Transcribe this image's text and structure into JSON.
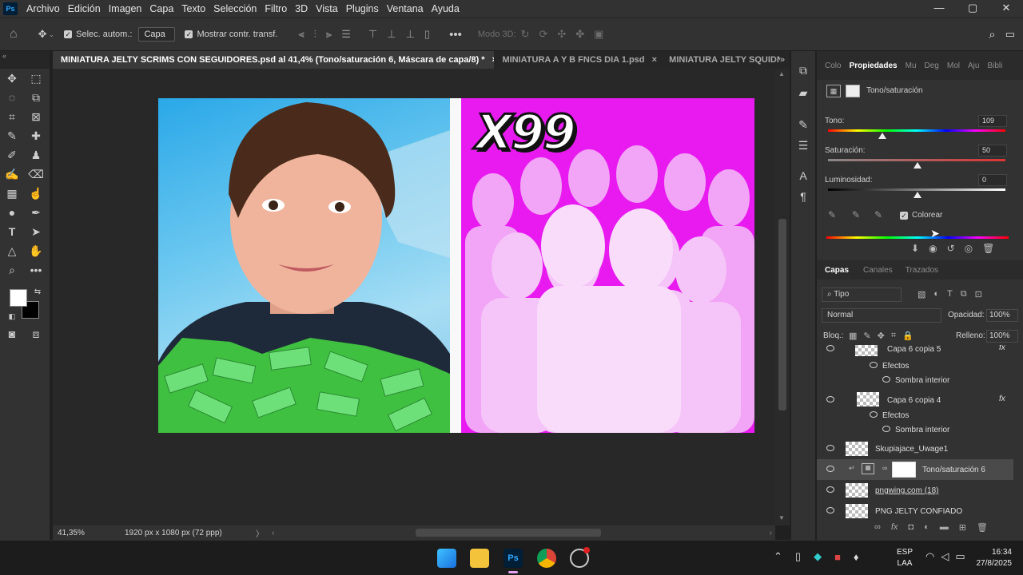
{
  "menu": {
    "items": [
      "Archivo",
      "Edición",
      "Imagen",
      "Capa",
      "Texto",
      "Selección",
      "Filtro",
      "3D",
      "Vista",
      "Plugins",
      "Ventana",
      "Ayuda"
    ]
  },
  "window_controls": {
    "minimize": "—",
    "restore": "▢",
    "close": "✕"
  },
  "options": {
    "auto_select_label": "Selec. autom.:",
    "auto_select_value": "Capa",
    "show_transform_label": "Mostrar contr. transf.",
    "mode3d_label": "Modo 3D:"
  },
  "tabs": [
    {
      "label": "MINIATURA JELTY SCRIMS CON SEGUIDORES.psd al 41,4% (Tono/saturación 6, Máscara de capa/8) *",
      "close": "×"
    },
    {
      "label": "MINIATURA A Y B FNCS DIA 1.psd",
      "close": "×"
    },
    {
      "label": "MINIATURA JELTY SQUIDNITE C",
      "close": ""
    }
  ],
  "tab_overflow": "»",
  "canvas": {
    "headline": "X99"
  },
  "status": {
    "zoom": "41,35%",
    "doc_info": "1920 px x 1080 px (72 ppp)"
  },
  "properties": {
    "tabs": [
      "Colo",
      "Propiedades",
      "Mu",
      "Deg",
      "Mol",
      "Aju",
      "Bibli"
    ],
    "title": "Tono/saturación",
    "tono_label": "Tono:",
    "tono_value": "109",
    "sat_label": "Saturación:",
    "sat_value": "50",
    "lum_label": "Luminosidad:",
    "lum_value": "0",
    "colorize_label": "Colorear"
  },
  "layers_panel": {
    "tabs": [
      "Capas",
      "Canales",
      "Trazados"
    ],
    "filter": "Tipo",
    "blend_mode": "Normal",
    "opacity_label": "Opacidad:",
    "opacity_value": "100%",
    "lock_label": "Bloq.:",
    "fill_label": "Relleno:",
    "fill_value": "100%",
    "layers": [
      {
        "name": "Capa 6 copia 5",
        "indent": false,
        "fx": true
      },
      {
        "name": "Efectos",
        "indent": true
      },
      {
        "name": "Sombra interior",
        "indent": true
      },
      {
        "name": "Capa 6 copia 4",
        "indent": false,
        "fx": true
      },
      {
        "name": "Efectos",
        "indent": true
      },
      {
        "name": "Sombra interior",
        "indent": true
      },
      {
        "name": "Skupiajace_Uwage1",
        "indent": false
      },
      {
        "name": "Tono/saturación 6",
        "indent": false,
        "selected": true
      },
      {
        "name": "pngwing.com (18)",
        "indent": false
      },
      {
        "name": "PNG JELTY CONFIADO",
        "indent": false
      }
    ],
    "fx_label": "fx"
  },
  "taskbar": {
    "lang_top": "ESP",
    "lang_bottom": "LAA",
    "time": "16:34",
    "date": "27/8/2025",
    "ps_label": "Ps"
  }
}
